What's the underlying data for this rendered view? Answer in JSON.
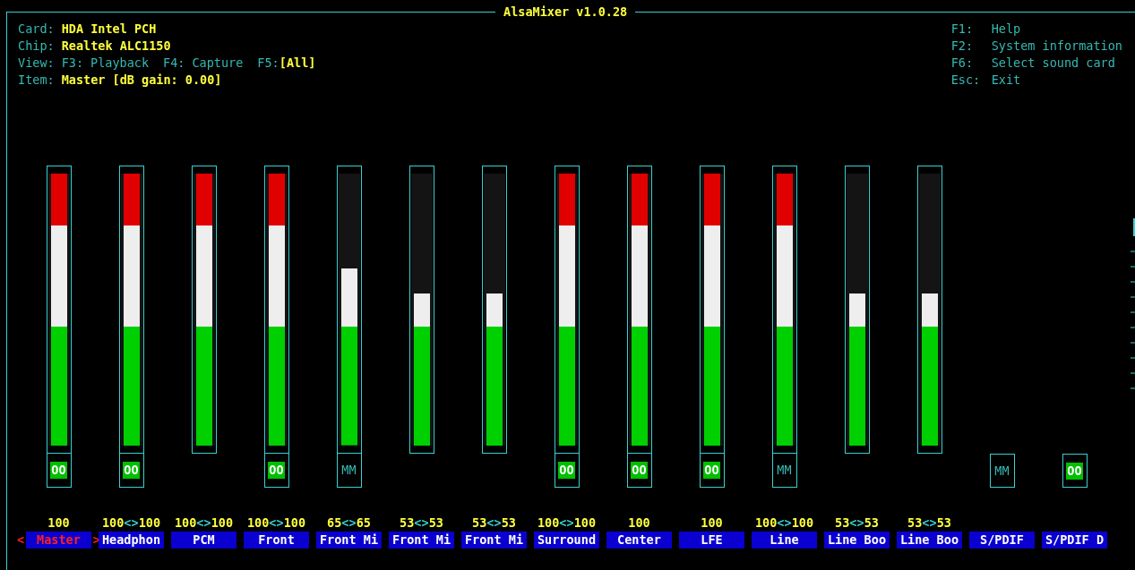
{
  "window": {
    "title": "AlsaMixer v1.0.28"
  },
  "info": [
    {
      "label": "Card:",
      "value": "HDA Intel PCH"
    },
    {
      "label": "Chip:",
      "value": "Realtek ALC1150"
    },
    {
      "label": "Item:",
      "value": "Master [dB gain: 0.00]"
    }
  ],
  "view": {
    "label": "View:",
    "options": [
      {
        "key": "F3:",
        "name": "Playback",
        "selected": false
      },
      {
        "key": "F4:",
        "name": "Capture",
        "selected": false
      },
      {
        "key": "F5:",
        "name": "[All]",
        "selected": true
      }
    ]
  },
  "help": [
    {
      "key": "F1:",
      "label": "Help"
    },
    {
      "key": "F2:",
      "label": "System information"
    },
    {
      "key": "F6:",
      "label": "Select sound card"
    },
    {
      "key": "Esc:",
      "label": "Exit"
    }
  ],
  "selection_marks": [
    "<",
    ">"
  ],
  "channels": [
    {
      "name": "Master",
      "kind": "volume",
      "level": 1,
      "reading": [
        "100"
      ],
      "switch": {
        "text": "OO",
        "muted": false
      },
      "selected": true
    },
    {
      "name": "Headphon",
      "kind": "volume",
      "level": 1,
      "reading": [
        "100",
        "<>",
        "100"
      ],
      "switch": {
        "text": "OO",
        "muted": false
      },
      "selected": false
    },
    {
      "name": "PCM",
      "kind": "volume",
      "level": 1,
      "reading": [
        "100",
        "<>",
        "100"
      ],
      "selected": false
    },
    {
      "name": "Front",
      "kind": "volume",
      "level": 1,
      "reading": [
        "100",
        "<>",
        "100"
      ],
      "switch": {
        "text": "OO",
        "muted": false
      },
      "selected": false
    },
    {
      "name": "Front Mi",
      "kind": "volume",
      "level": 0.65,
      "reading": [
        "65",
        "<>",
        "65"
      ],
      "switch": {
        "text": "MM",
        "muted": true
      },
      "selected": false
    },
    {
      "name": "Front Mi",
      "kind": "volume",
      "level": 0.56,
      "reading": [
        "53",
        "<>",
        "53"
      ],
      "selected": false
    },
    {
      "name": "Front Mi",
      "kind": "volume",
      "level": 0.56,
      "reading": [
        "53",
        "<>",
        "53"
      ],
      "selected": false
    },
    {
      "name": "Surround",
      "kind": "volume",
      "level": 1,
      "reading": [
        "100",
        "<>",
        "100"
      ],
      "switch": {
        "text": "OO",
        "muted": false
      },
      "selected": false
    },
    {
      "name": "Center",
      "kind": "volume",
      "level": 1,
      "reading": [
        "100"
      ],
      "switch": {
        "text": "OO",
        "muted": false
      },
      "selected": false
    },
    {
      "name": "LFE",
      "kind": "volume",
      "level": 1,
      "reading": [
        "100"
      ],
      "switch": {
        "text": "OO",
        "muted": false
      },
      "selected": false
    },
    {
      "name": "Line",
      "kind": "volume",
      "level": 1,
      "reading": [
        "100",
        "<>",
        "100"
      ],
      "switch": {
        "text": "MM",
        "muted": true
      },
      "selected": false
    },
    {
      "name": "Line Boo",
      "kind": "volume",
      "level": 0.56,
      "reading": [
        "53",
        "<>",
        "53"
      ],
      "selected": false
    },
    {
      "name": "Line Boo",
      "kind": "volume",
      "level": 0.56,
      "reading": [
        "53",
        "<>",
        "53"
      ],
      "selected": false
    },
    {
      "name": "S/PDIF",
      "kind": "switch",
      "switch": {
        "text": "MM",
        "muted": true
      },
      "selected": false
    },
    {
      "name": "S/PDIF D",
      "kind": "switch",
      "switch": {
        "text": "OO",
        "muted": false
      },
      "selected": false
    }
  ]
}
